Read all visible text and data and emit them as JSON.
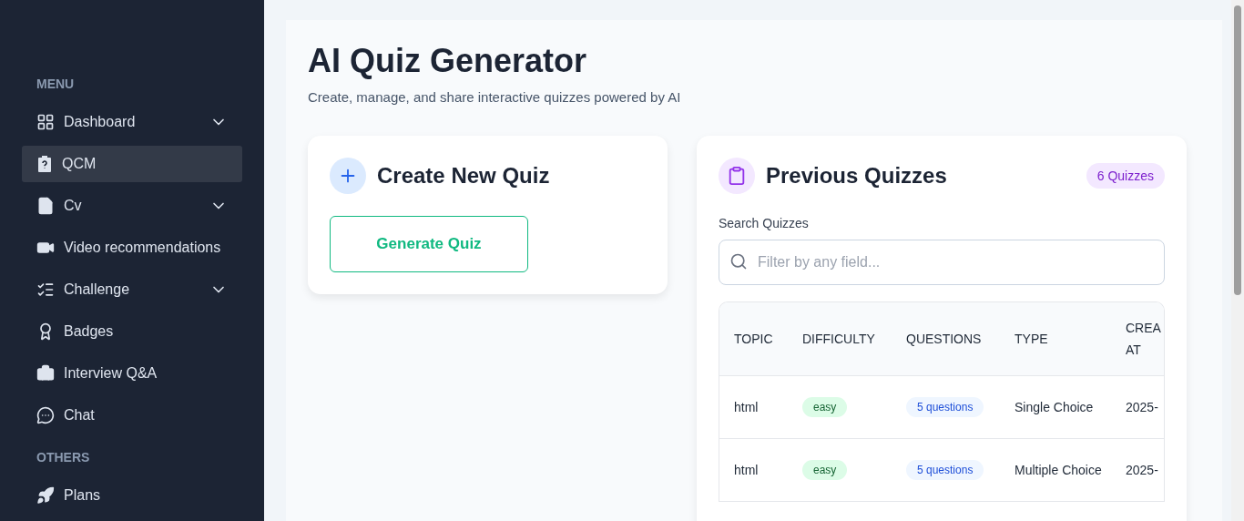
{
  "sidebar": {
    "sections": [
      {
        "title": "MENU",
        "items": [
          {
            "label": "Dashboard",
            "expandable": true,
            "selected": false
          },
          {
            "label": "QCM",
            "expandable": false,
            "selected": true
          },
          {
            "label": "Cv",
            "expandable": true,
            "selected": false
          },
          {
            "label": "Video recommendations",
            "expandable": false,
            "selected": false
          },
          {
            "label": "Challenge",
            "expandable": true,
            "selected": false
          },
          {
            "label": "Badges",
            "expandable": false,
            "selected": false
          },
          {
            "label": "Interview Q&A",
            "expandable": false,
            "selected": false
          },
          {
            "label": "Chat",
            "expandable": false,
            "selected": false
          }
        ]
      },
      {
        "title": "OTHERS",
        "items": [
          {
            "label": "Plans",
            "expandable": false,
            "selected": false
          }
        ]
      }
    ]
  },
  "page": {
    "title": "AI Quiz Generator",
    "subtitle": "Create, manage, and share interactive quizzes powered by AI"
  },
  "create_card": {
    "title": "Create New Quiz",
    "button": "Generate Quiz"
  },
  "previous_card": {
    "title": "Previous Quizzes",
    "count_badge": "6 Quizzes",
    "search_label": "Search Quizzes",
    "search": {
      "placeholder": "Filter by any field..."
    },
    "table": {
      "columns": [
        "TOPIC",
        "DIFFICULTY",
        "QUESTIONS",
        "TYPE",
        "CREA AT"
      ],
      "rows": [
        {
          "topic": "html",
          "difficulty": "easy",
          "questions": "5 questions",
          "type": "Single Choice",
          "created": "2025-"
        },
        {
          "topic": "html",
          "difficulty": "easy",
          "questions": "5 questions",
          "type": "Multiple Choice",
          "created": "2025-"
        }
      ]
    }
  }
}
